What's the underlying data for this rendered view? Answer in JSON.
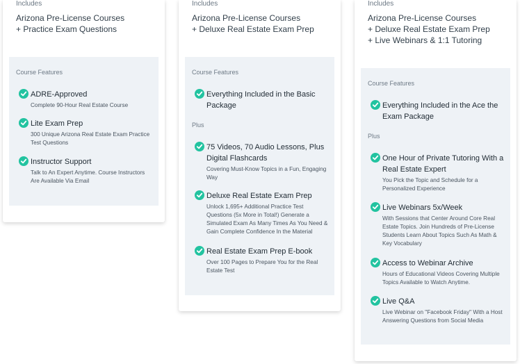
{
  "cards": [
    {
      "includes_label": "Includes",
      "includes_lines": [
        "Arizona Pre-License Courses",
        "+ Practice Exam Questions"
      ],
      "features_title": "Course Features",
      "features": [
        {
          "title": "ADRE-Approved",
          "desc": "Complete 90-Hour Real Estate Course"
        },
        {
          "title": "Lite Exam Prep",
          "desc": "300 Unique Arizona Real Estate Exam Practice Test Questions"
        },
        {
          "title": "Instructor Support",
          "desc": "Talk to An Expert Anytime. Course Instructors Are Available Via Email"
        }
      ]
    },
    {
      "includes_label": "Includes",
      "includes_lines": [
        "Arizona Pre-License Courses",
        "+ Deluxe Real Estate Exam Prep"
      ],
      "features_title": "Course Features",
      "base_feature": {
        "title": "Everything Included in the Basic Package"
      },
      "plus_label": "Plus",
      "features": [
        {
          "title": "75 Videos, 70 Audio Lessons, Plus Digital Flashcards",
          "desc": "Covering Must-Know Topics in a Fun, Engaging Way"
        },
        {
          "title": "Deluxe Real Estate Exam Prep",
          "desc": "Unlock 1,695+ Additional Practice Test Questions (5x More in Total!) Generate a Simulated Exam As Many Times As You Need & Gain Complete Confidence In the Material"
        },
        {
          "title": "Real Estate Exam Prep E-book",
          "desc": "Over 100 Pages to Prepare You for the Real Estate Test"
        }
      ]
    },
    {
      "includes_label": "Includes",
      "includes_lines": [
        "Arizona Pre-License Courses",
        "+ Deluxe Real Estate Exam Prep",
        "+ Live Webinars & 1:1 Tutoring"
      ],
      "features_title": "Course Features",
      "base_feature": {
        "title": "Everything Included in the Ace the Exam Package"
      },
      "plus_label": "Plus",
      "features": [
        {
          "title": "One Hour of Private Tutoring With a Real Estate Expert",
          "desc": "You Pick the Topic and Schedule for a Personalized Experience"
        },
        {
          "title": "Live Webinars 5x/Week",
          "desc": "With Sessions that Center Around Core Real Estate Topics. Join Hundreds of Pre-License Students Learn About Topics Such As Math & Key Vocabulary"
        },
        {
          "title": "Access to Webinar Archive",
          "desc": "Hours of Educational Videos Covering Multiple Topics Available to Watch Anytime."
        },
        {
          "title": "Live Q&A",
          "desc": "Live Webinar on \"Facebook Friday\" With a Host Answering Questions from Social Media"
        }
      ]
    }
  ],
  "colors": {
    "check": "#22c3a0",
    "features_bg": "#eef2f6"
  },
  "icons": {
    "feature": "check-circle-icon"
  }
}
